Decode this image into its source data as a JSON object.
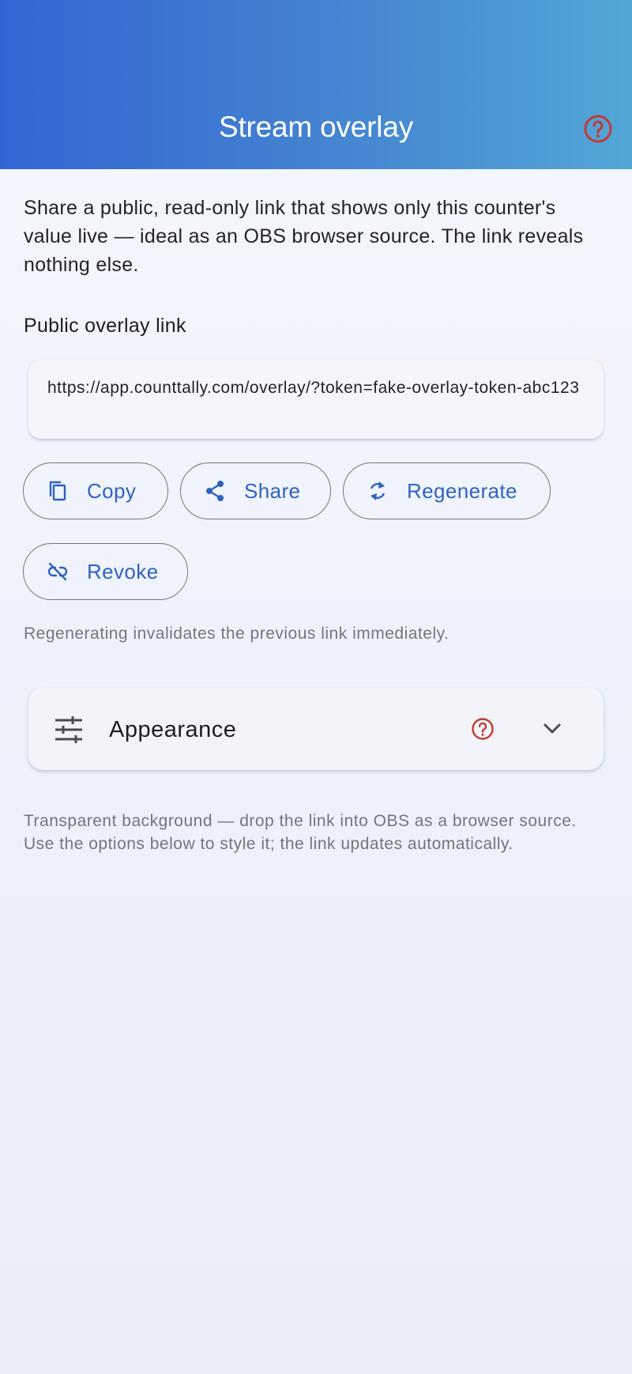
{
  "header": {
    "title": "Stream overlay",
    "help_icon": "help-circle-icon"
  },
  "intro": "Share a public, read-only link that shows only this counter's value live — ideal as an OBS browser source. The link reveals nothing else.",
  "link_section": {
    "label": "Public overlay link",
    "url": "https://app.counttally.com/overlay/?token=fake-overlay-token-abc123"
  },
  "actions": {
    "copy": {
      "label": "Copy",
      "icon": "copy-icon"
    },
    "share": {
      "label": "Share",
      "icon": "share-icon"
    },
    "regenerate": {
      "label": "Regenerate",
      "icon": "refresh-icon"
    },
    "revoke": {
      "label": "Revoke",
      "icon": "link-off-icon"
    }
  },
  "hint": "Regenerating invalidates the previous link immediately.",
  "appearance": {
    "title": "Appearance",
    "icon": "tune-icon",
    "help_icon": "help-circle-icon",
    "expand_icon": "chevron-down-icon"
  },
  "note": "Transparent background — drop the link into OBS as a browser source. Use the options below to style it; the link updates automatically.",
  "colors": {
    "accent": "#2f62c2",
    "header_gradient_start": "#3565d3",
    "header_gradient_end": "#52a6d6",
    "help_red": "#c23b33"
  }
}
